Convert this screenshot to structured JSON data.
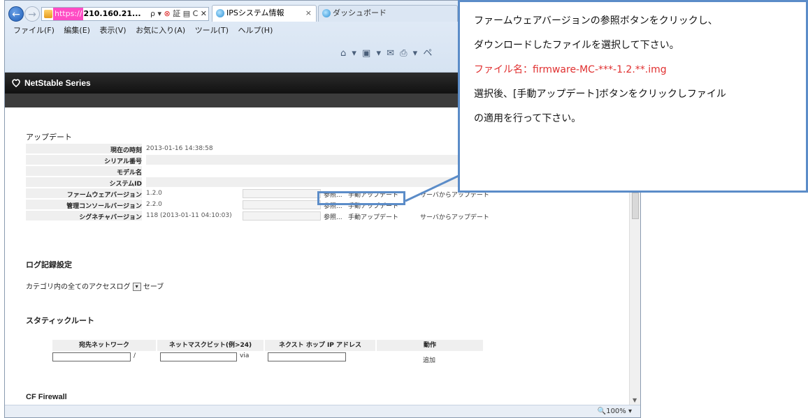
{
  "browser": {
    "address_https": "https://",
    "address_host": "210.160.21...",
    "address_controls": "ρ ▾ ",
    "address_controls_red": "⊗",
    "address_controls_rest": " 証 ▤ C ✕",
    "tab_active": "IPSシステム情報",
    "tab_inactive": "ダッシュボード",
    "tab_close": "×",
    "menu": [
      "ファイル(F)",
      "編集(E)",
      "表示(V)",
      "お気に入り(A)",
      "ツール(T)",
      "ヘルプ(H)"
    ],
    "cmdbar": "⌂ ▾ ▣ ▾ ✉ ⎙ ▾ ペ",
    "zoom": "🔍100%  ▾"
  },
  "page": {
    "brand": "NetStable Series",
    "update_title": "アップデート",
    "rows": [
      {
        "label": "現在の時刻",
        "value": "2013-01-16 14:38:58"
      },
      {
        "label": "シリアル番号",
        "value": ""
      },
      {
        "label": "モデル名",
        "value": ""
      },
      {
        "label": "システムID",
        "value": ""
      },
      {
        "label": "ファームウェアバージョン",
        "value": "1.2.0"
      },
      {
        "label": "管理コンソールバージョン",
        "value": "2.2.0"
      },
      {
        "label": "シグネチャバージョン",
        "value": "118 (2013-01-11 04:10:03)"
      }
    ],
    "browse_label": "参照...",
    "manual_update_label": "手動アップデート",
    "server_update_label": "サーバからアップデート",
    "log_title": "ログ記録設定",
    "log_select": "カテゴリ内の全てのアクセスログ",
    "log_select_arrow": "▾",
    "log_save": "セーブ",
    "static_title": "スタティックルート",
    "table_headers": [
      "宛先ネットワーク",
      "ネットマスクビット(例>24)",
      "ネクスト ホップ IP アドレス",
      "動作"
    ],
    "sep_slash": "/",
    "sep_via": "via",
    "add_label": "追加",
    "cf_title": "CF Firewall"
  },
  "callout": {
    "line1": "ファームウェアバージョンの参照ボタンをクリックし、",
    "line2": "ダウンロードしたファイルを選択して下さい。",
    "line3": "ファイル名：firmware-MC-***-1.2.**.img",
    "line4": "選択後、[手動アップデート]ボタンをクリックしファイル",
    "line5": "の適用を行って下さい。"
  },
  "colors": {
    "callout_border": "#5b8cc8",
    "callout_red": "#e03030",
    "https_pink": "#ff4cc4"
  }
}
